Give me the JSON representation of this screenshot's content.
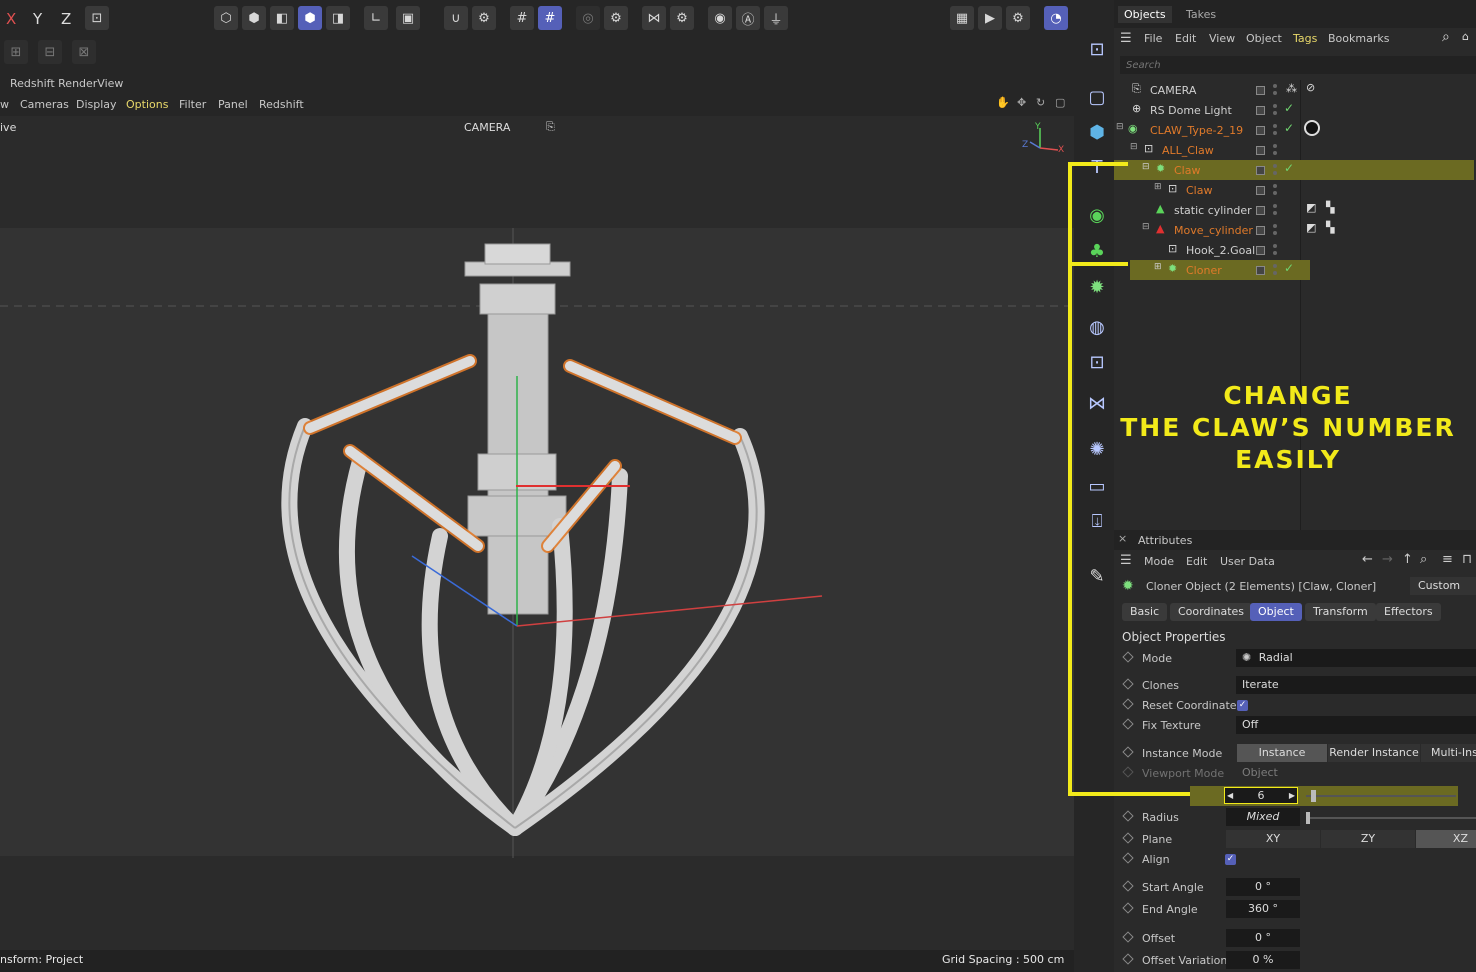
{
  "toolbar": {
    "axis_x": "X",
    "axis_y": "Y",
    "axis_z": "Z"
  },
  "viewport": {
    "panel_title": "Redshift RenderView",
    "menu": [
      "w",
      "Cameras",
      "Display",
      "Options",
      "Filter",
      "Panel",
      "Redshift"
    ],
    "view_name": "ive",
    "camera_label": "CAMERA",
    "status_left": "nsform: Project",
    "status_right": "Grid Spacing : 500 cm",
    "axis_y": "Y",
    "axis_z": "Z",
    "axis_x": "X"
  },
  "objects": {
    "tabs": [
      "Objects",
      "Takes"
    ],
    "menu": [
      "File",
      "Edit",
      "View",
      "Object",
      "Tags",
      "Bookmarks"
    ],
    "search_placeholder": "Search",
    "rows": [
      {
        "name": "CAMERA",
        "color": "#d0d0d0"
      },
      {
        "name": "RS Dome Light",
        "color": "#d0d0d0"
      },
      {
        "name": "CLAW_Type-2_19",
        "color": "#e07a2a"
      },
      {
        "name": "ALL_Claw",
        "color": "#e07a2a"
      },
      {
        "name": "Claw",
        "color": "#e07a2a"
      },
      {
        "name": "Claw",
        "color": "#e07a2a"
      },
      {
        "name": "static cylinder",
        "color": "#d0d0d0"
      },
      {
        "name": "Move_cylinder",
        "color": "#e07a2a"
      },
      {
        "name": "Hook_2.Goal",
        "color": "#d0d0d0"
      },
      {
        "name": "Cloner",
        "color": "#e07a2a"
      }
    ]
  },
  "annotation": {
    "line1": "CHANGE",
    "line2": "THE CLAW’S NUMBER",
    "line3": "EASILY"
  },
  "attributes": {
    "title": "Attributes",
    "menu": [
      "Mode",
      "Edit",
      "User Data"
    ],
    "object_title": "Cloner Object (2 Elements) [Claw, Cloner]",
    "custom": "Custom",
    "tabs": [
      "Basic",
      "Coordinates",
      "Object",
      "Transform",
      "Effectors"
    ],
    "section": "Object Properties",
    "mode_label": "Mode",
    "mode_value": "Radial",
    "clones_label": "Clones",
    "clones_value": "Iterate",
    "reset_label": "Reset Coordinates",
    "fix_label": "Fix Texture",
    "fix_value": "Off",
    "instance_label": "Instance Mode",
    "instance_opts": [
      "Instance",
      "Render Instance",
      "Multi-Inst"
    ],
    "viewport_label": "Viewport Mode",
    "viewport_value": "Object",
    "count_value": "6",
    "radius_label": "Radius",
    "radius_value": "Mixed",
    "plane_label": "Plane",
    "plane_opts": [
      "XY",
      "ZY",
      "XZ"
    ],
    "align_label": "Align",
    "start_label": "Start Angle",
    "start_value": "0 °",
    "end_label": "End Angle",
    "end_value": "360 °",
    "offset_label": "Offset",
    "offset_value": "0 °",
    "offvar_label": "Offset Variation",
    "offvar_value": "0 %"
  },
  "colors": {
    "accent": "#5560b8",
    "highlight": "#f2ea1a",
    "selection": "#6b6a22",
    "orange": "#e07a2a"
  }
}
